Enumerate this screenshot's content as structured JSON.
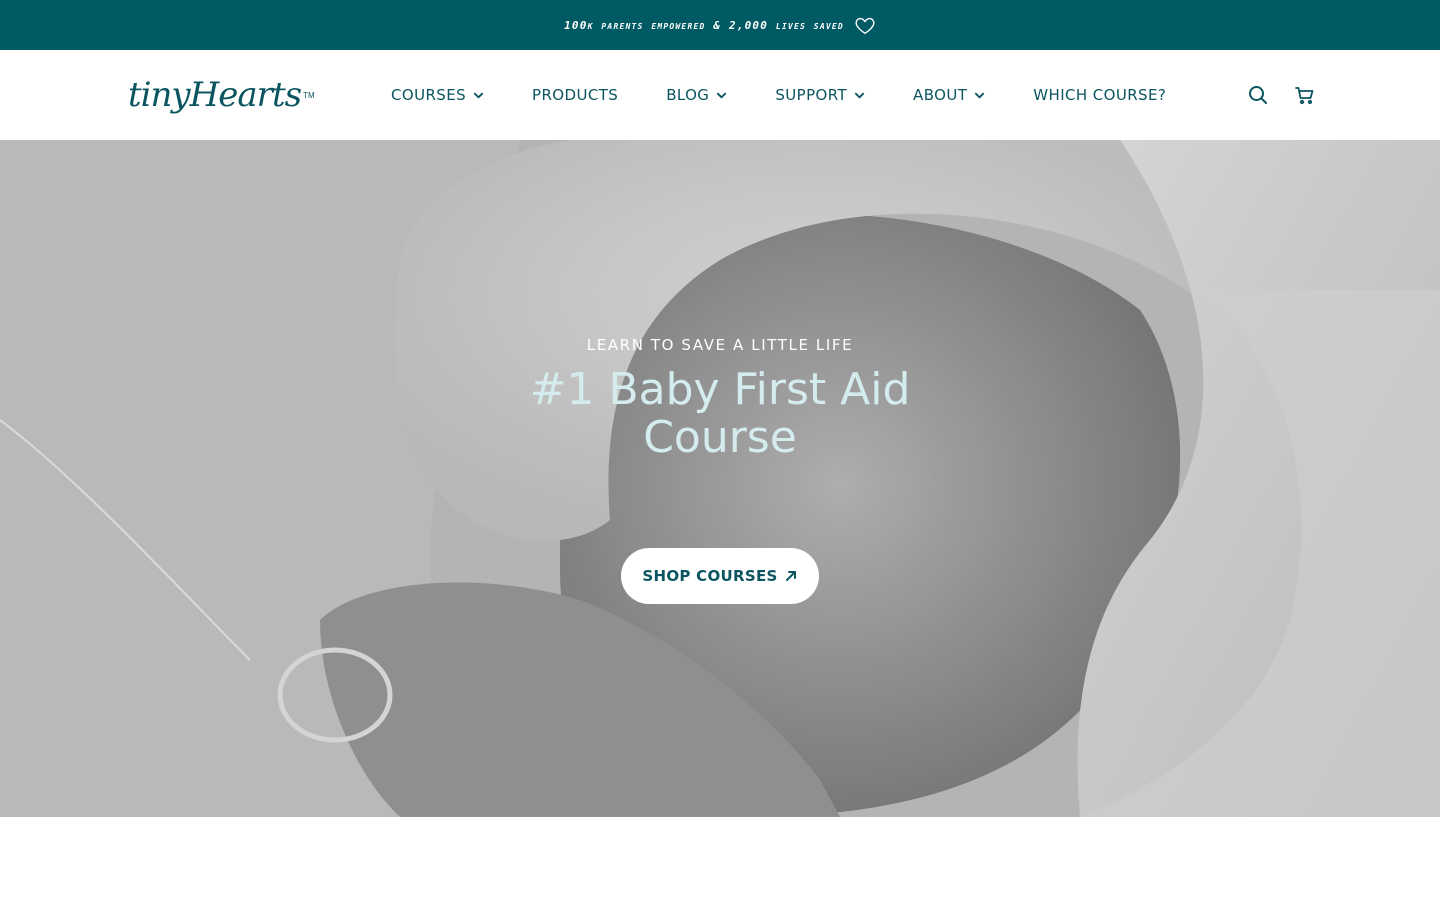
{
  "announcement": {
    "text": "100K PARENTS EMPOWERED & 2,000 LIVES SAVED",
    "icon": "heart-icon"
  },
  "header": {
    "logo": {
      "text": "tinyHearts",
      "tm": "TM"
    },
    "nav": [
      {
        "label": "COURSES",
        "has_dropdown": true
      },
      {
        "label": "PRODUCTS",
        "has_dropdown": false
      },
      {
        "label": "BLOG",
        "has_dropdown": true
      },
      {
        "label": "SUPPORT",
        "has_dropdown": true
      },
      {
        "label": "ABOUT",
        "has_dropdown": true
      },
      {
        "label": "WHICH COURSE?",
        "has_dropdown": false
      }
    ],
    "icons": [
      "search-icon",
      "cart-icon"
    ]
  },
  "hero": {
    "eyebrow": "LEARN TO SAVE A LITTLE LIFE",
    "title": "#1 Baby First Aid Course",
    "cta": "SHOP COURSES",
    "cta_icon": "arrow-up-right-icon"
  },
  "colors": {
    "brand_teal": "#005a64",
    "nav_text": "#0b5560",
    "hero_title": "#d4ecee",
    "white": "#ffffff"
  }
}
